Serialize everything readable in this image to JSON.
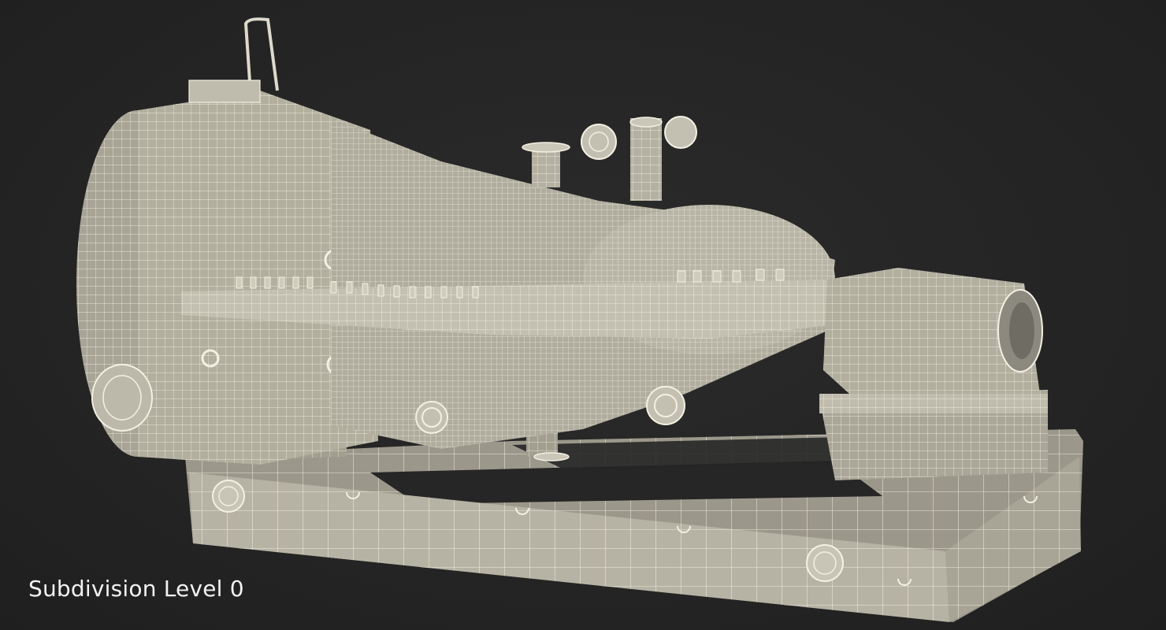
{
  "caption": "Subdivision Level 0",
  "colors": {
    "background": "#262626",
    "surface": "#bdb9aa",
    "surface_dark": "#8c897e",
    "wire": "#f3f0e4",
    "caption_text": "#f2f2f2"
  }
}
